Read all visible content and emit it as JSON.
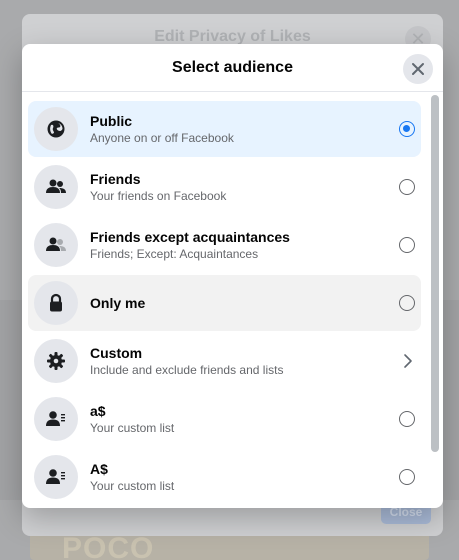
{
  "background_dialog": {
    "title": "Edit Privacy of Likes",
    "close_glyph": "✕",
    "footer_button": "Close"
  },
  "background_page": {
    "banner_text": "POCO"
  },
  "dialog": {
    "title": "Select audience",
    "close_icon": "close-icon"
  },
  "options": [
    {
      "title": "Public",
      "subtitle": "Anyone on or off Facebook",
      "icon": "globe-icon",
      "control": "radio",
      "selected": true
    },
    {
      "title": "Friends",
      "subtitle": "Your friends on Facebook",
      "icon": "friends-icon",
      "control": "radio",
      "selected": false
    },
    {
      "title": "Friends except acquaintances",
      "subtitle": "Friends; Except: Acquaintances",
      "icon": "friends-except-icon",
      "control": "radio",
      "selected": false
    },
    {
      "title": "Only me",
      "subtitle": "",
      "icon": "lock-icon",
      "control": "radio",
      "selected": false
    },
    {
      "title": "Custom",
      "subtitle": "Include and exclude friends and lists",
      "icon": "gear-icon",
      "control": "chevron",
      "selected": false
    },
    {
      "title": "a$",
      "subtitle": "Your custom list",
      "icon": "custom-list-icon",
      "control": "radio",
      "selected": false
    },
    {
      "title": "A$",
      "subtitle": "Your custom list",
      "icon": "custom-list-icon",
      "control": "radio",
      "selected": false
    }
  ],
  "colors": {
    "accent": "#1877f2",
    "selected_bg": "#e7f3ff",
    "hover_bg": "#f2f2f2"
  }
}
